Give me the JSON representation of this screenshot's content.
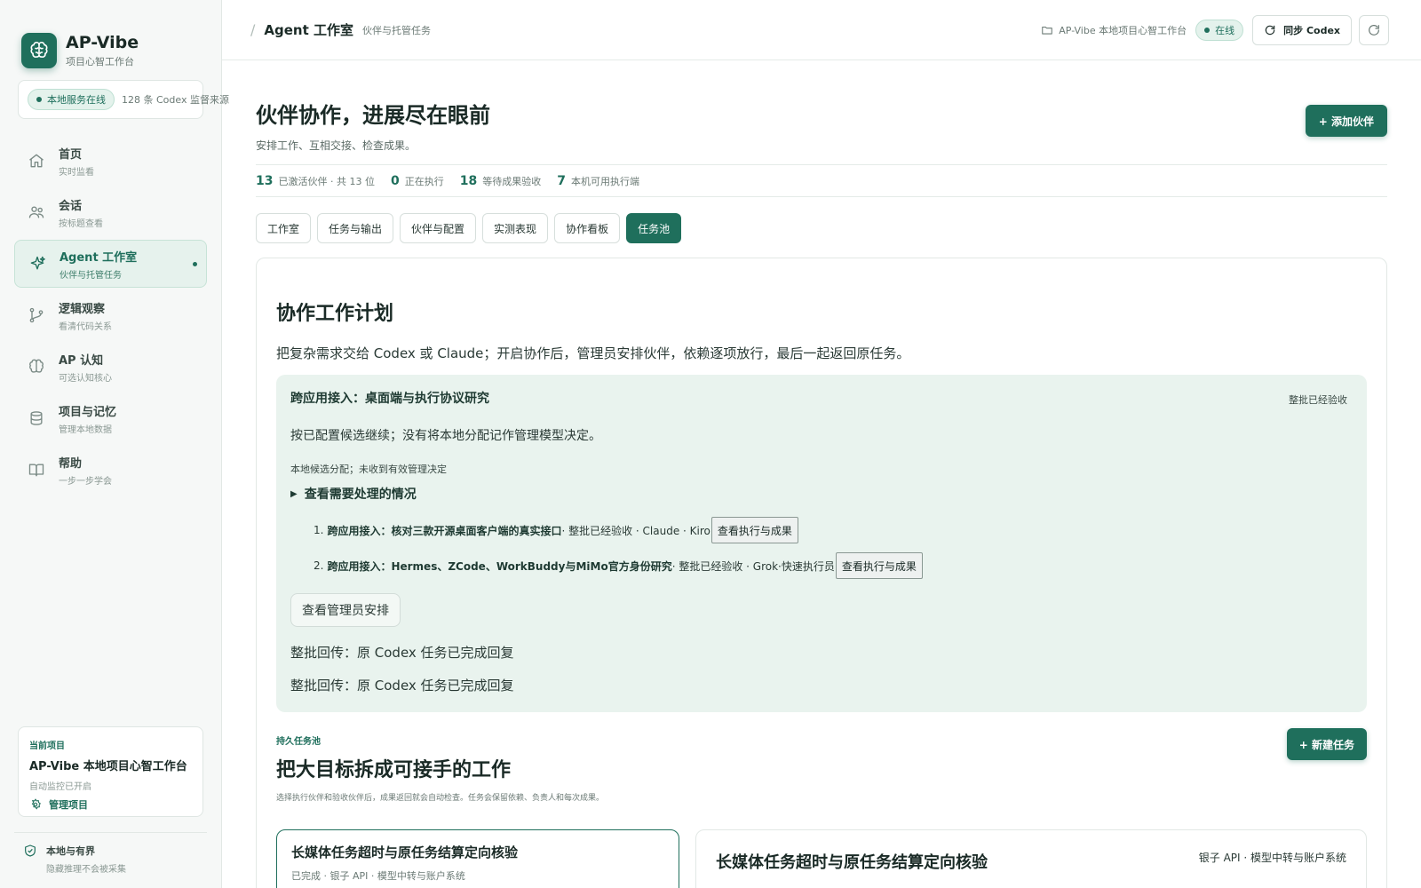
{
  "app": {
    "title": "AP-Vibe",
    "subtitle": "项目心智工作台"
  },
  "sidebar": {
    "status": {
      "online_label": "本地服务在线",
      "source_count": "128 条 Codex 监督来源"
    },
    "items": [
      {
        "label": "首页",
        "sub": "实时监看",
        "icon": "home-icon"
      },
      {
        "label": "会话",
        "sub": "按标题查看",
        "icon": "users-icon"
      },
      {
        "label": "Agent 工作室",
        "sub": "伙伴与托管任务",
        "icon": "sparkle-icon",
        "active": true
      },
      {
        "label": "逻辑观察",
        "sub": "看清代码关系",
        "icon": "branch-icon"
      },
      {
        "label": "AP 认知",
        "sub": "可选认知核心",
        "icon": "brain-icon"
      },
      {
        "label": "项目与记忆",
        "sub": "管理本地数据",
        "icon": "database-icon"
      },
      {
        "label": "帮助",
        "sub": "一步一步学会",
        "icon": "book-icon"
      }
    ],
    "project": {
      "kicker": "当前项目",
      "title": "AP-Vibe 本地项目心智工作台",
      "status": "自动监控已开启",
      "manage_label": "管理项目"
    },
    "footer": {
      "title": "本地与有界",
      "sub": "隐藏推理不会被采集"
    }
  },
  "topbar": {
    "slash": "/",
    "title": "Agent 工作室",
    "subtitle": "伙伴与托管任务",
    "workspace": "AP-Vibe 本地项目心智工作台",
    "online": "在线",
    "sync_label": "同步 Codex"
  },
  "hero": {
    "title": "伙伴协作，进展尽在眼前",
    "subtitle": "安排工作、互相交接、检查成果。",
    "add_partner": "+ 添加伙伴"
  },
  "stats": [
    {
      "num": "13",
      "label": "已激活伙伴 · 共 13 位"
    },
    {
      "num": "0",
      "label": "正在执行"
    },
    {
      "num": "18",
      "label": "等待成果验收"
    },
    {
      "num": "7",
      "label": "本机可用执行端"
    }
  ],
  "tabs": [
    {
      "label": "工作室"
    },
    {
      "label": "任务与输出"
    },
    {
      "label": "伙伴与配置"
    },
    {
      "label": "实测表现"
    },
    {
      "label": "协作看板"
    },
    {
      "label": "任务池",
      "active": true
    }
  ],
  "plan": {
    "title": "协作工作计划",
    "desc": "把复杂需求交给 Codex 或 Claude；开启协作后，管理员安排伙伴，依赖逐项放行，最后一起返回原任务。",
    "box_title": "跨应用接入：桌面端与执行协议研究",
    "badge": "整批已经验收",
    "note": "按已配置候选继续；没有将本地分配记作管理模型决定。",
    "state": "本地候选分配；未收到有效管理决定",
    "toggle": "查看需要处理的情况",
    "items": [
      {
        "num": "1.",
        "title": "跨应用接入：核对三款开源桌面客户端的真实接口",
        "meta": " · 整批已经验收 · Claude · Kiro",
        "button": "查看执行与成果"
      },
      {
        "num": "2.",
        "title": "跨应用接入：Hermes、ZCode、WorkBuddy与MiMo官方身份研究",
        "meta": " · 整批已经验收 · Grok·快速执行员",
        "button": "查看执行与成果"
      }
    ],
    "admin_button": "查看管理员安排",
    "returns": [
      "整批回传：原 Codex 任务已完成回复",
      "整批回传：原 Codex 任务已完成回复"
    ]
  },
  "pool": {
    "kicker": "持久任务池",
    "title": "把大目标拆成可接手的工作",
    "subtitle": "选择执行伙伴和验收伙伴后，成果返回就会自动检查。任务会保留依赖、负责人和每次成果。",
    "new_task": "+ 新建任务",
    "cards": [
      {
        "title": "长媒体任务超时与原任务结算定向核验",
        "sub": "已完成 · 银子 API · 模型中转与账户系统"
      },
      {
        "title": "长媒体任务超时与原任务结算定向核验",
        "tag": "银子 API · 模型中转与账户系统"
      }
    ]
  },
  "colors": {
    "accent": "#1f6f5c",
    "accent_soft": "#e9f3ee",
    "online_bg": "#e4f2ec"
  }
}
